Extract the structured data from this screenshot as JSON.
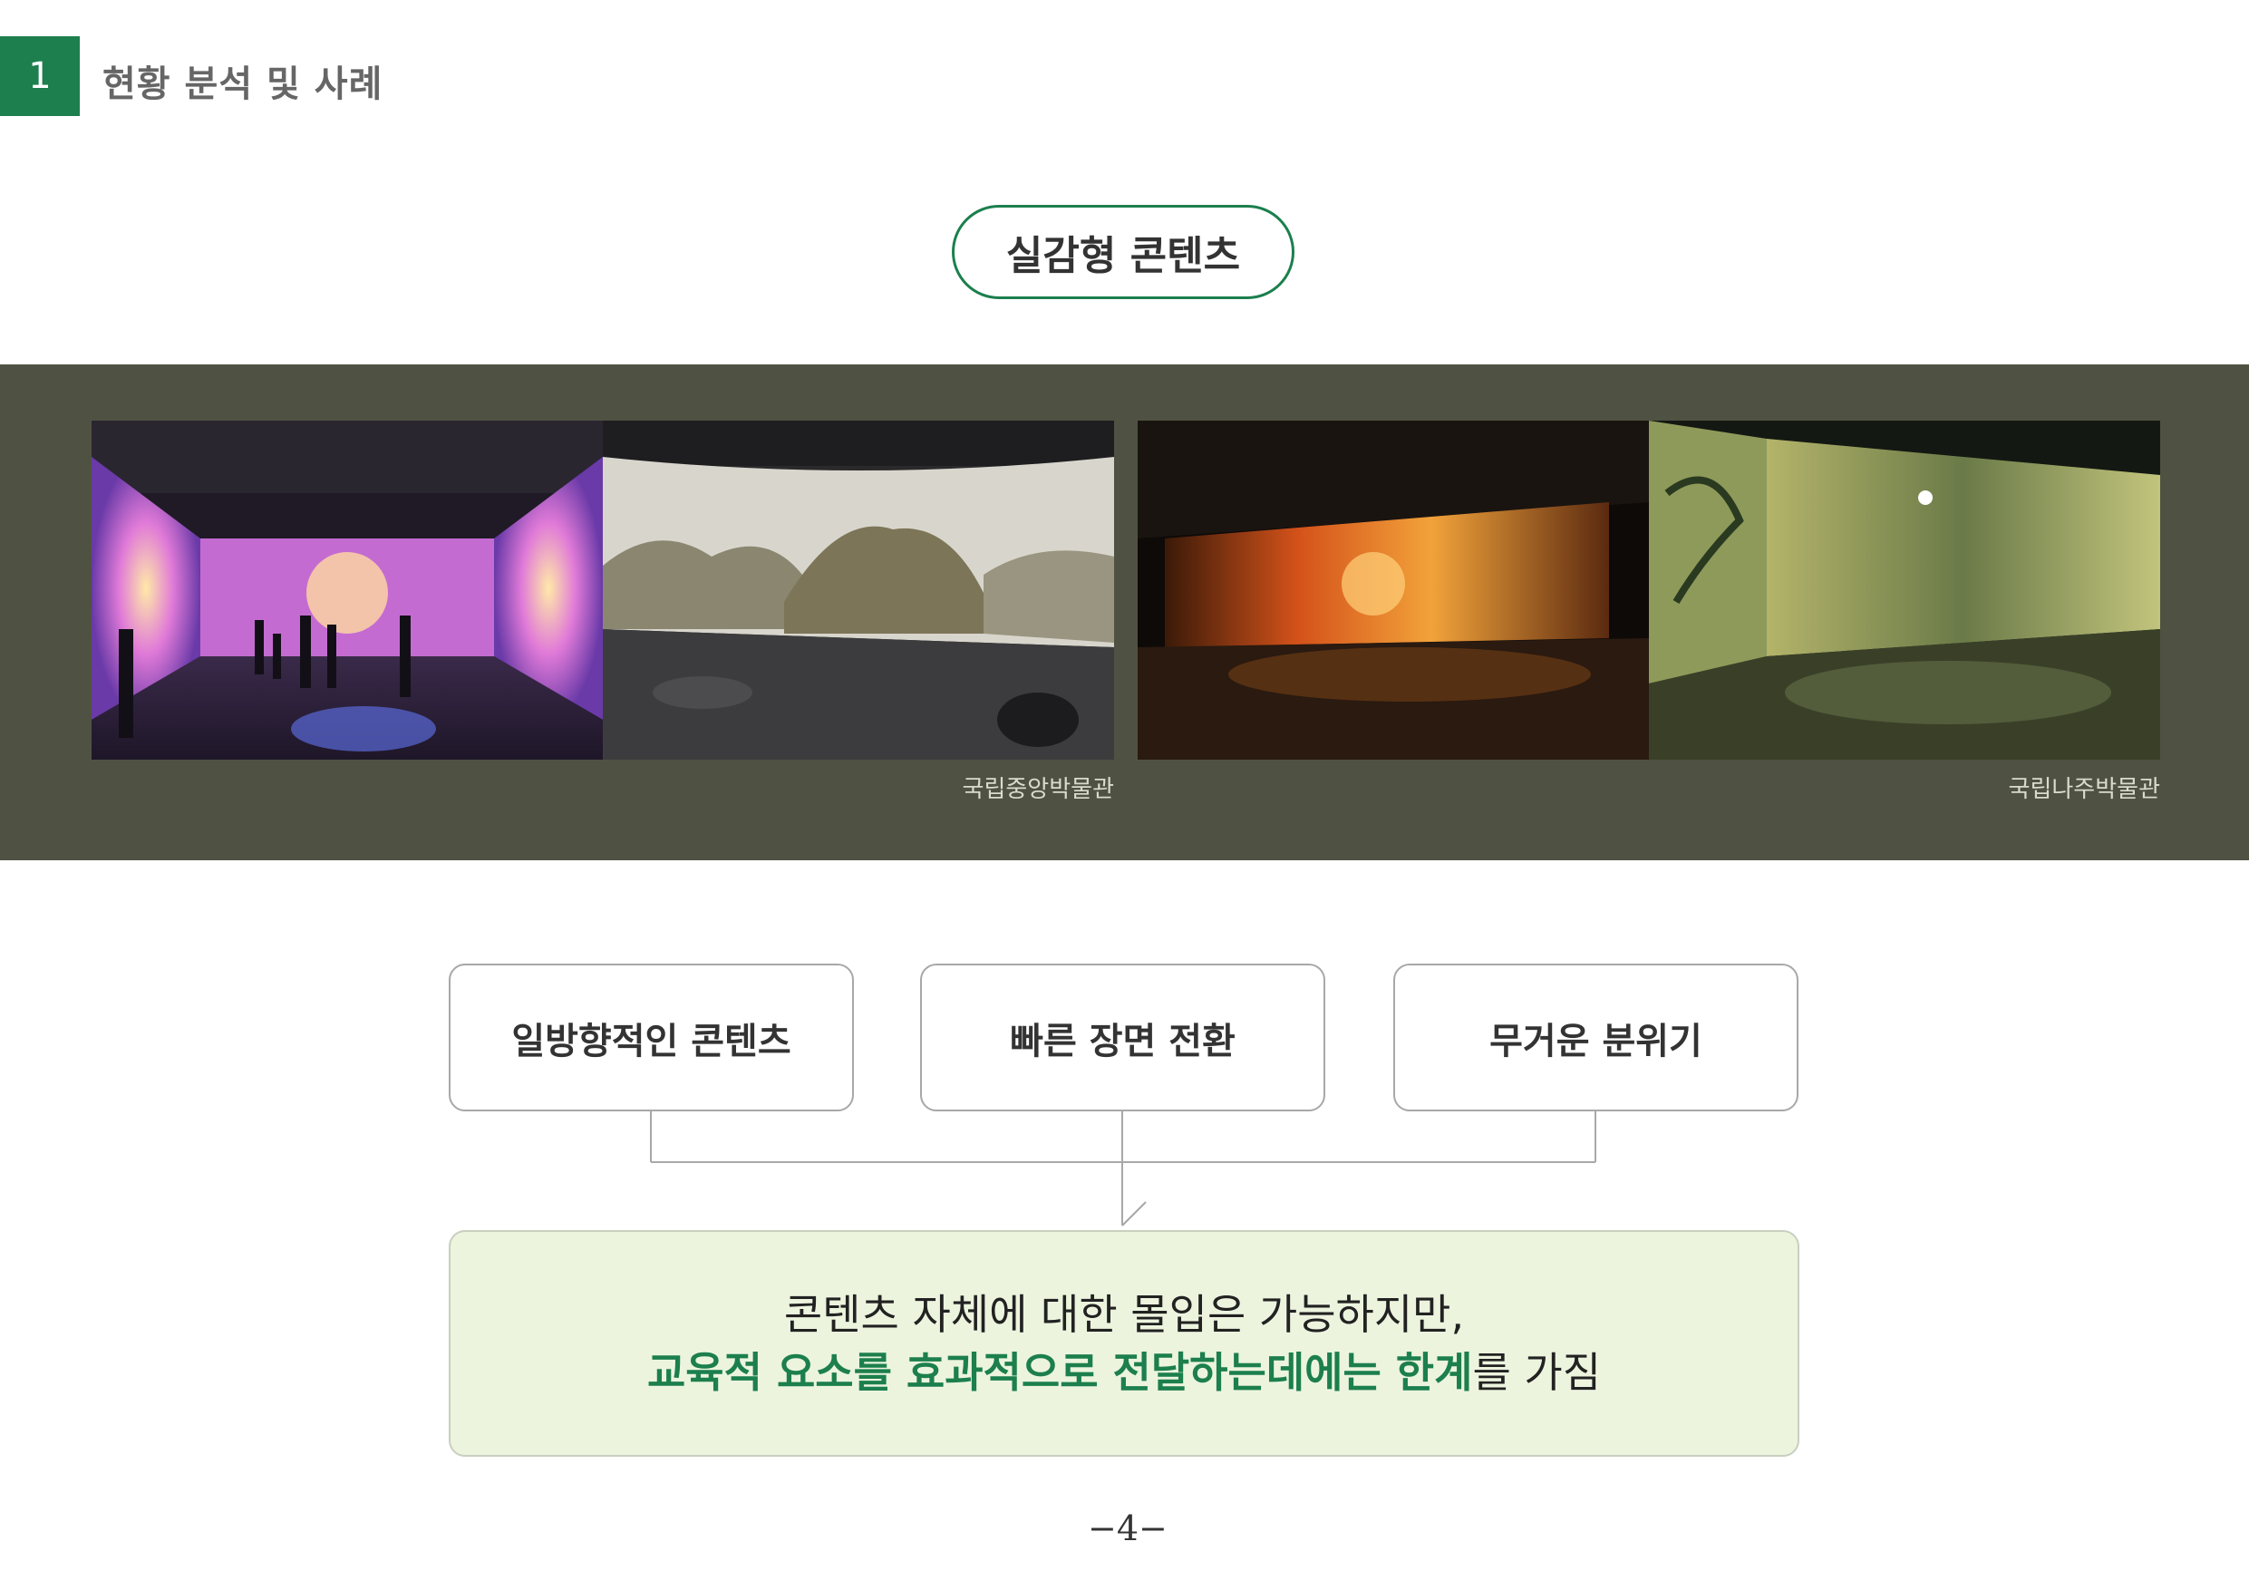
{
  "header": {
    "number": "1",
    "title": "현황 분석 및 사례"
  },
  "section_title": "실감형 콘텐츠",
  "gallery": {
    "captions": [
      "국립중앙박물관",
      "국립나주박물관"
    ]
  },
  "issues": [
    {
      "label": "일방향적인 콘텐츠"
    },
    {
      "label": "빠른 장면 전환"
    },
    {
      "label": "무거운 분위기"
    }
  ],
  "conclusion": {
    "line1": "콘텐츠 자체에 대한 몰입은 가능하지만,",
    "line2_highlight": "교육적 요소를 효과적으로 전달하는데에는 한계",
    "line2_rest": "를 가짐"
  },
  "footer": {
    "page": "−4−"
  },
  "colors": {
    "accent": "#1c7f4d",
    "band": "#4f5242",
    "conclusion_bg": "#ecf4de"
  }
}
